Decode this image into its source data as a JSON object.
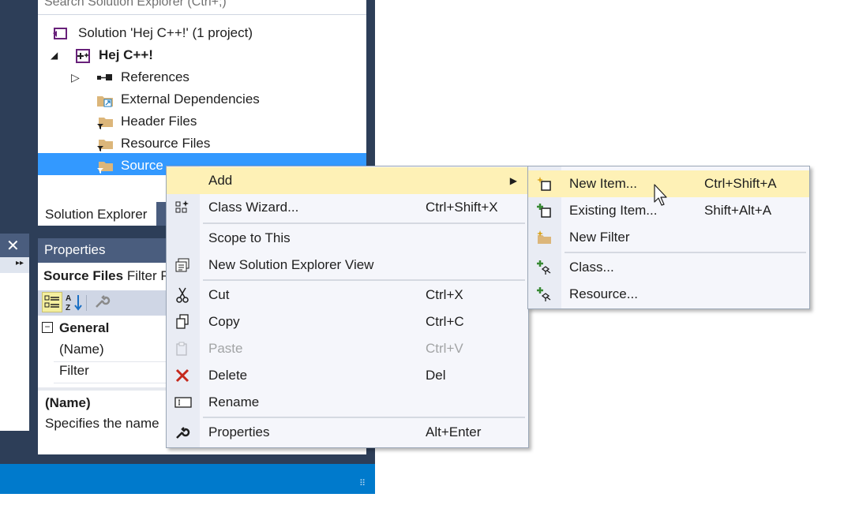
{
  "solution_explorer": {
    "search_placeholder": "Search Solution Explorer (Ctrl+;)",
    "tab_label": "Solution Explorer",
    "tree": [
      {
        "label": "Solution 'Hej C++!' (1 project)",
        "icon": "solution-icon"
      },
      {
        "label": "Hej C++!",
        "icon": "cpp-project-icon",
        "bold": true,
        "expander": "expanded"
      },
      {
        "label": "References",
        "icon": "references-icon",
        "expander": "collapsed"
      },
      {
        "label": "External Dependencies",
        "icon": "external-deps-folder-icon"
      },
      {
        "label": "Header Files",
        "icon": "filter-folder-icon"
      },
      {
        "label": "Resource Files",
        "icon": "filter-folder-icon"
      },
      {
        "label": "Source Files",
        "icon": "filter-folder-icon",
        "selected": true
      }
    ],
    "selected_visible_label": "Source Fil"
  },
  "properties": {
    "title": "Properties",
    "object_name": "Source Files",
    "object_type": "Filter Properties",
    "object_type_visible": "Filter P",
    "category": "General",
    "category_toggle": "−",
    "rows": [
      "(Name)",
      "Filter"
    ],
    "desc_title": "(Name)",
    "desc_text": "Specifies the name"
  },
  "left_panel": {
    "close_glyph": "✕",
    "arrows": "▸▸"
  },
  "context_menu": {
    "items": [
      {
        "label": "Add",
        "submenu": true,
        "highlighted": true,
        "icon": ""
      },
      {
        "label": "Class Wizard...",
        "shortcut": "Ctrl+Shift+X",
        "icon": "class-wizard-icon"
      },
      {
        "label": "Scope to This",
        "shortcut": "",
        "icon": ""
      },
      {
        "label": "New Solution Explorer View",
        "shortcut": "",
        "icon": "new-view-icon"
      },
      {
        "label": "Cut",
        "shortcut": "Ctrl+X",
        "icon": "cut-icon"
      },
      {
        "label": "Copy",
        "shortcut": "Ctrl+C",
        "icon": "copy-icon"
      },
      {
        "label": "Paste",
        "shortcut": "Ctrl+V",
        "icon": "paste-icon",
        "disabled": true
      },
      {
        "label": "Delete",
        "shortcut": "Del",
        "icon": "delete-icon"
      },
      {
        "label": "Rename",
        "shortcut": "",
        "icon": "rename-icon"
      },
      {
        "label": "Properties",
        "shortcut": "Alt+Enter",
        "icon": "wrench-icon"
      }
    ]
  },
  "add_submenu": {
    "items": [
      {
        "label": "New Item...",
        "shortcut": "Ctrl+Shift+A",
        "icon": "new-item-icon",
        "highlighted": true
      },
      {
        "label": "Existing Item...",
        "shortcut": "Shift+Alt+A",
        "icon": "existing-item-icon"
      },
      {
        "label": "New Filter",
        "shortcut": "",
        "icon": "new-filter-icon"
      },
      {
        "label": "Class...",
        "shortcut": "",
        "icon": "add-class-icon"
      },
      {
        "label": "Resource...",
        "shortcut": "",
        "icon": "add-resource-icon"
      }
    ]
  },
  "colors": {
    "ide_background": "#2d3e58",
    "panel_header": "#4a5d7e",
    "status_bar": "#007acc",
    "selection": "#3399ff",
    "menu_highlight": "#fef1b6",
    "menu_background": "#f5f6fb"
  }
}
